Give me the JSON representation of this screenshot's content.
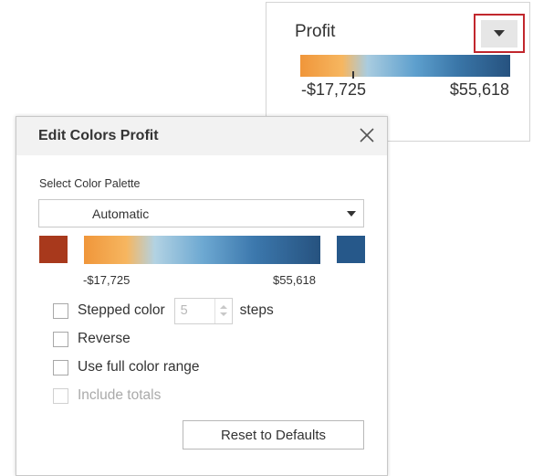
{
  "legend": {
    "title": "Profit",
    "min_label": "-$17,725",
    "max_label": "$55,618",
    "dropdown_icon": "chevron-down-icon",
    "highlight_color": "#c1272d"
  },
  "dialog": {
    "title": "Edit Colors Profit",
    "close_icon": "close-icon",
    "palette_label": "Select Color Palette",
    "palette_value": "Automatic",
    "start_color": "#a8391c",
    "end_color": "#26588a",
    "gradient_min": "-$17,725",
    "gradient_max": "$55,618",
    "stepped_color": {
      "label": "Stepped color",
      "checked": false,
      "steps_value": "5",
      "steps_label": "steps"
    },
    "reverse": {
      "label": "Reverse",
      "checked": false
    },
    "full_range": {
      "label": "Use full color range",
      "checked": false
    },
    "include_totals": {
      "label": "Include totals",
      "checked": false,
      "disabled": true
    },
    "reset_label": "Reset to Defaults"
  },
  "colors": {
    "gradient_low": "#f0963a",
    "gradient_high": "#26527f"
  }
}
